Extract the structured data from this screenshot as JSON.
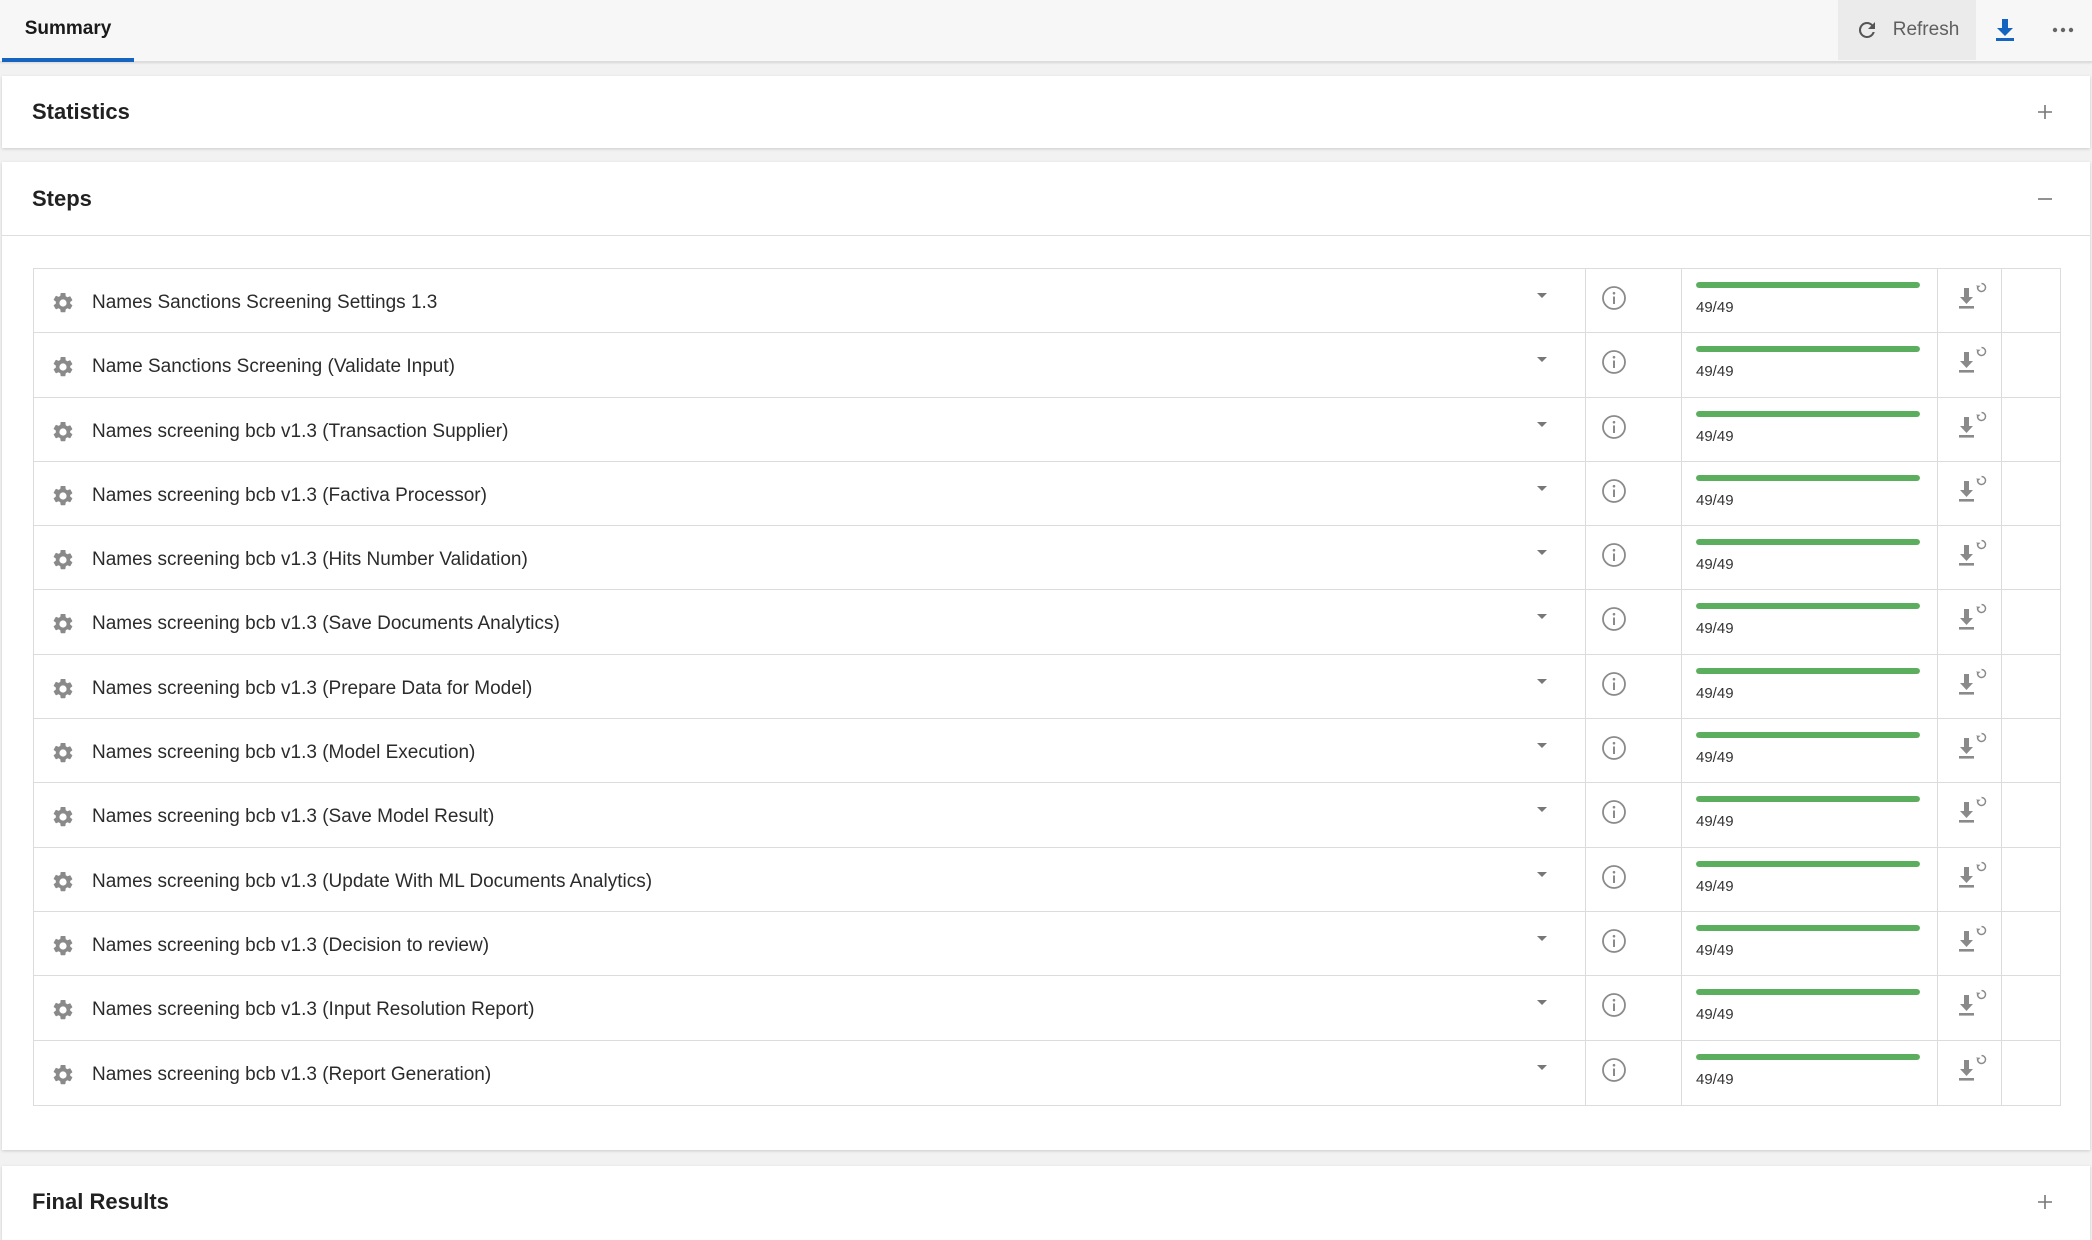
{
  "tabs": [
    {
      "label": "Summary",
      "active": true
    }
  ],
  "toolbar": {
    "refresh_label": "Refresh"
  },
  "colors": {
    "accent": "#1565c0",
    "progress": "#5cae5f"
  },
  "panels": {
    "statistics": {
      "title": "Statistics",
      "toggle": "+"
    },
    "steps": {
      "title": "Steps",
      "toggle": "−"
    },
    "final": {
      "title": "Final Results",
      "toggle": "+"
    }
  },
  "steps": [
    {
      "name": "Names Sanctions Screening Settings 1.3",
      "done": 49,
      "total": 49,
      "progress_label": "49/49"
    },
    {
      "name": "Name Sanctions Screening (Validate Input)",
      "done": 49,
      "total": 49,
      "progress_label": "49/49"
    },
    {
      "name": "Names screening bcb v1.3 (Transaction Supplier)",
      "done": 49,
      "total": 49,
      "progress_label": "49/49"
    },
    {
      "name": "Names screening bcb v1.3 (Factiva Processor)",
      "done": 49,
      "total": 49,
      "progress_label": "49/49"
    },
    {
      "name": "Names screening bcb v1.3 (Hits Number Validation)",
      "done": 49,
      "total": 49,
      "progress_label": "49/49"
    },
    {
      "name": "Names screening bcb v1.3 (Save Documents Analytics)",
      "done": 49,
      "total": 49,
      "progress_label": "49/49"
    },
    {
      "name": "Names screening bcb v1.3 (Prepare Data for Model)",
      "done": 49,
      "total": 49,
      "progress_label": "49/49"
    },
    {
      "name": "Names screening bcb v1.3 (Model Execution)",
      "done": 49,
      "total": 49,
      "progress_label": "49/49"
    },
    {
      "name": "Names screening bcb v1.3 (Save Model Result)",
      "done": 49,
      "total": 49,
      "progress_label": "49/49"
    },
    {
      "name": "Names screening bcb v1.3 (Update With ML Documents Analytics)",
      "done": 49,
      "total": 49,
      "progress_label": "49/49"
    },
    {
      "name": "Names screening bcb v1.3 (Decision to review)",
      "done": 49,
      "total": 49,
      "progress_label": "49/49"
    },
    {
      "name": "Names screening bcb v1.3 (Input Resolution Report)",
      "done": 49,
      "total": 49,
      "progress_label": "49/49"
    },
    {
      "name": "Names screening bcb v1.3 (Report Generation)",
      "done": 49,
      "total": 49,
      "progress_label": "49/49"
    }
  ]
}
